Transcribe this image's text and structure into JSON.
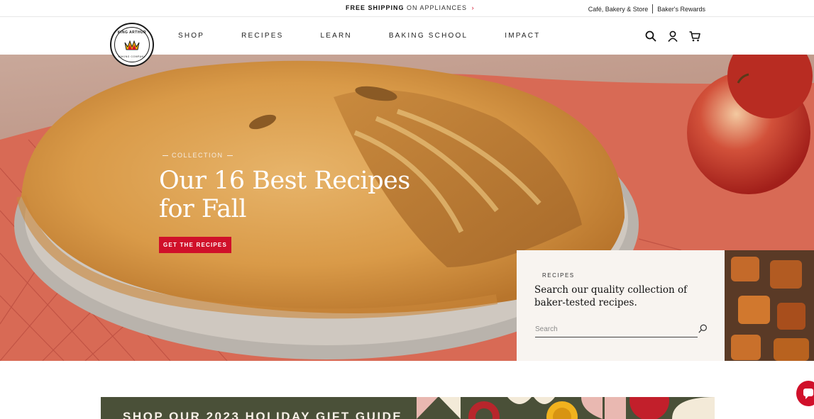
{
  "promo": {
    "bold": "FREE SHIPPING",
    "rest": "ON APPLIANCES",
    "links": [
      "Café, Bakery & Store",
      "Baker's Rewards"
    ]
  },
  "logo": {
    "top_text": "KING ARTHUR",
    "bottom_text": "BAKING COMPANY"
  },
  "nav": [
    "SHOP",
    "RECIPES",
    "LEARN",
    "BAKING SCHOOL",
    "IMPACT"
  ],
  "icons": [
    "search-icon",
    "account-icon",
    "cart-icon"
  ],
  "hero": {
    "eyebrow": "COLLECTION",
    "title": "Our 16 Best Recipes for Fall",
    "cta": "GET THE RECIPES"
  },
  "search_card": {
    "eyebrow": "RECIPES",
    "title": "Search our quality collection of baker-tested recipes.",
    "placeholder": "Search"
  },
  "holiday": {
    "text": "SHOP OUR 2023 HOLIDAY GIFT GUIDE"
  },
  "colors": {
    "brand_red": "#d0102a",
    "hero_bg": "#d85f4a",
    "card_bg": "#f8f4f0",
    "holiday_green": "#4a5038"
  }
}
